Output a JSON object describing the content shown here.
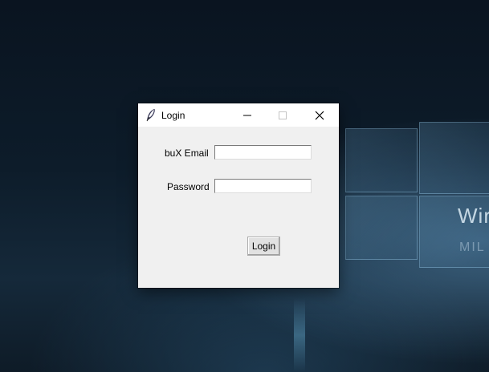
{
  "window": {
    "title": "Login",
    "app_icon": "feather-icon",
    "controls": {
      "minimize": "minimize-icon",
      "maximize": "maximize-icon",
      "close": "close-icon"
    }
  },
  "form": {
    "email_label": "buX Email",
    "email_value": "",
    "password_label": "Password",
    "password_value": "",
    "login_button": "Login"
  },
  "desktop": {
    "logo_text": "Wir",
    "logo_subtext": "MIL"
  }
}
